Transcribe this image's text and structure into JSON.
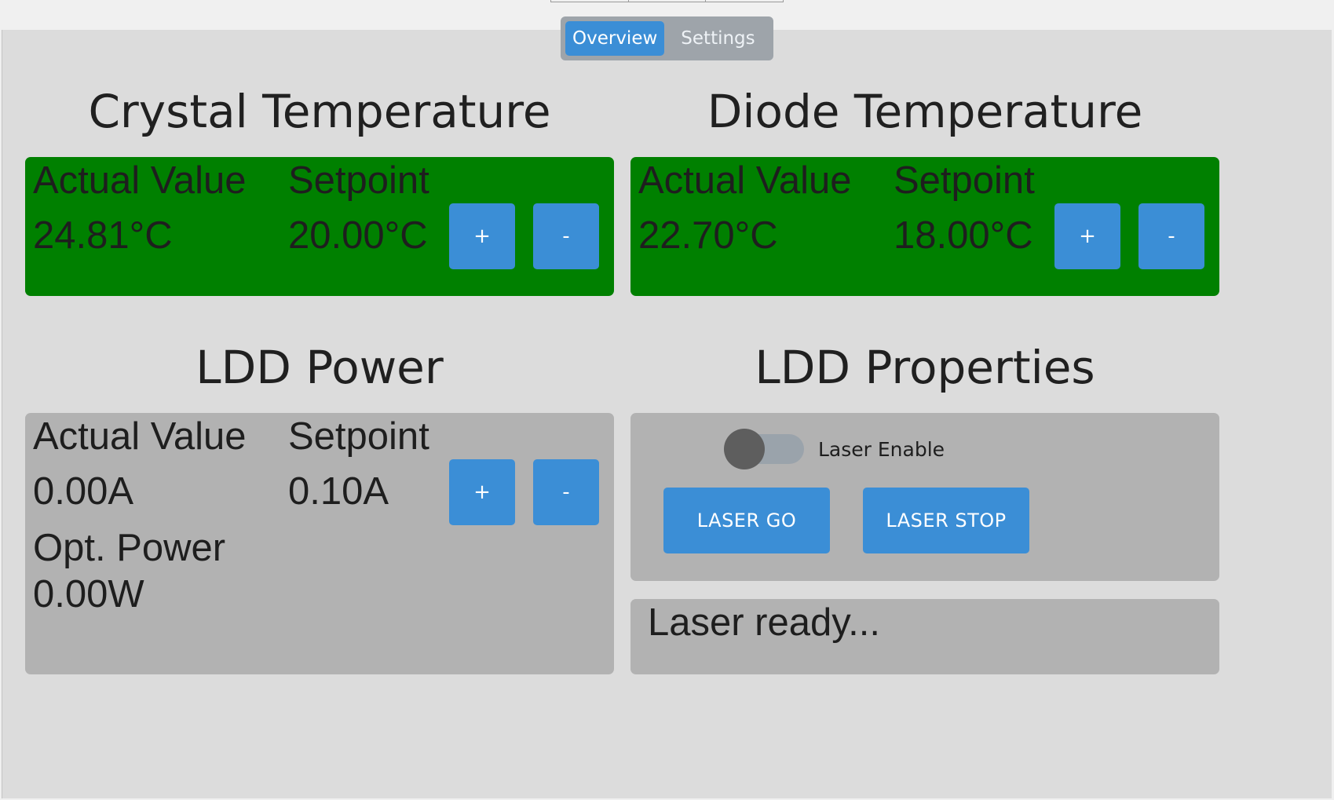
{
  "tabs": [
    {
      "label": "Overview",
      "active": true
    },
    {
      "label": "Settings",
      "active": false
    }
  ],
  "crystal": {
    "title": "Crystal Temperature",
    "actual_label": "Actual Value",
    "setpoint_label": "Setpoint",
    "actual_value": "24.81°C",
    "setpoint_value": "20.00°C",
    "plus_label": "+",
    "minus_label": "-"
  },
  "diode": {
    "title": "Diode Temperature",
    "actual_label": "Actual Value",
    "setpoint_label": "Setpoint",
    "actual_value": "22.70°C",
    "setpoint_value": "18.00°C",
    "plus_label": "+",
    "minus_label": "-"
  },
  "ldd_power": {
    "title": "LDD Power",
    "actual_label": "Actual Value",
    "setpoint_label": "Setpoint",
    "actual_value": "0.00A",
    "setpoint_value": "0.10A",
    "opt_power_label": "Opt. Power",
    "opt_power_value": "0.00W",
    "plus_label": "+",
    "minus_label": "-"
  },
  "ldd_properties": {
    "title": "LDD Properties",
    "laser_enable_label": "Laser Enable",
    "laser_enable_on": false,
    "laser_go_label": "LASER GO",
    "laser_stop_label": "LASER STOP",
    "status_text": "Laser ready..."
  },
  "colors": {
    "ok_panel": "#008000",
    "neutral_panel": "#b2b2b2",
    "accent": "#3b8ed6"
  }
}
